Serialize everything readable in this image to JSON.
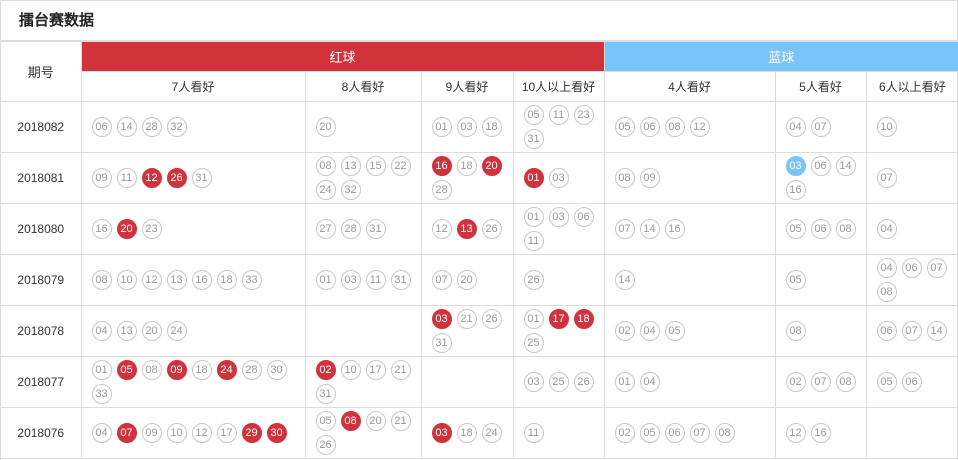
{
  "title": "擂台赛数据",
  "header": {
    "period_label": "期号",
    "red_label": "红球",
    "blue_label": "蓝球",
    "red_columns": [
      "7人看好",
      "8人看好",
      "9人看好",
      "10人以上看好"
    ],
    "blue_columns": [
      "4人看好",
      "5人看好",
      "6人以上看好"
    ]
  },
  "colors": {
    "red": "#d0333b",
    "blue": "#79c5fb",
    "border": "#dddddd"
  },
  "rows": [
    {
      "period": "2018082",
      "red": [
        [
          {
            "n": "06"
          },
          {
            "n": "14"
          },
          {
            "n": "28"
          },
          {
            "n": "32"
          }
        ],
        [
          {
            "n": "20"
          }
        ],
        [
          {
            "n": "01"
          },
          {
            "n": "03"
          },
          {
            "n": "18"
          }
        ],
        [
          {
            "n": "05"
          },
          {
            "n": "11"
          },
          {
            "n": "23"
          },
          {
            "n": "31"
          }
        ]
      ],
      "blue": [
        [
          {
            "n": "05"
          },
          {
            "n": "06"
          },
          {
            "n": "08"
          },
          {
            "n": "12"
          }
        ],
        [
          {
            "n": "04"
          },
          {
            "n": "07"
          }
        ],
        [
          {
            "n": "10"
          }
        ]
      ]
    },
    {
      "period": "2018081",
      "red": [
        [
          {
            "n": "09"
          },
          {
            "n": "11"
          },
          {
            "n": "12",
            "hit": true
          },
          {
            "n": "26",
            "hit": true
          },
          {
            "n": "31"
          }
        ],
        [
          {
            "n": "08"
          },
          {
            "n": "13"
          },
          {
            "n": "15"
          },
          {
            "n": "22"
          },
          {
            "n": "24"
          },
          {
            "n": "32"
          }
        ],
        [
          {
            "n": "16",
            "hit": true
          },
          {
            "n": "18"
          },
          {
            "n": "20",
            "hit": true
          },
          {
            "n": "28"
          }
        ],
        [
          {
            "n": "01",
            "hit": true
          },
          {
            "n": "03"
          }
        ]
      ],
      "blue": [
        [
          {
            "n": "08"
          },
          {
            "n": "09"
          }
        ],
        [
          {
            "n": "03",
            "hit": true
          },
          {
            "n": "06"
          },
          {
            "n": "14"
          },
          {
            "n": "16"
          }
        ],
        [
          {
            "n": "07"
          }
        ]
      ]
    },
    {
      "period": "2018080",
      "red": [
        [
          {
            "n": "16"
          },
          {
            "n": "20",
            "hit": true
          },
          {
            "n": "23"
          }
        ],
        [
          {
            "n": "27"
          },
          {
            "n": "28"
          },
          {
            "n": "31"
          }
        ],
        [
          {
            "n": "12"
          },
          {
            "n": "13",
            "hit": true
          },
          {
            "n": "26"
          }
        ],
        [
          {
            "n": "01"
          },
          {
            "n": "03"
          },
          {
            "n": "06"
          },
          {
            "n": "11"
          }
        ]
      ],
      "blue": [
        [
          {
            "n": "07"
          },
          {
            "n": "14"
          },
          {
            "n": "16"
          }
        ],
        [
          {
            "n": "05"
          },
          {
            "n": "06"
          },
          {
            "n": "08"
          }
        ],
        [
          {
            "n": "04"
          }
        ]
      ]
    },
    {
      "period": "2018079",
      "red": [
        [
          {
            "n": "08"
          },
          {
            "n": "10"
          },
          {
            "n": "12"
          },
          {
            "n": "13"
          },
          {
            "n": "16"
          },
          {
            "n": "18"
          },
          {
            "n": "33"
          }
        ],
        [
          {
            "n": "01"
          },
          {
            "n": "03"
          },
          {
            "n": "11"
          },
          {
            "n": "31"
          }
        ],
        [
          {
            "n": "07"
          },
          {
            "n": "20"
          }
        ],
        [
          {
            "n": "26"
          }
        ]
      ],
      "blue": [
        [
          {
            "n": "14"
          }
        ],
        [
          {
            "n": "05"
          }
        ],
        [
          {
            "n": "04"
          },
          {
            "n": "06"
          },
          {
            "n": "07"
          },
          {
            "n": "08"
          }
        ]
      ]
    },
    {
      "period": "2018078",
      "red": [
        [
          {
            "n": "04"
          },
          {
            "n": "13"
          },
          {
            "n": "20"
          },
          {
            "n": "24"
          }
        ],
        [],
        [
          {
            "n": "03",
            "hit": true
          },
          {
            "n": "21"
          },
          {
            "n": "26"
          },
          {
            "n": "31"
          }
        ],
        [
          {
            "n": "01"
          },
          {
            "n": "17",
            "hit": true
          },
          {
            "n": "18",
            "hit": true
          },
          {
            "n": "25"
          }
        ]
      ],
      "blue": [
        [
          {
            "n": "02"
          },
          {
            "n": "04"
          },
          {
            "n": "05"
          }
        ],
        [
          {
            "n": "08"
          }
        ],
        [
          {
            "n": "06"
          },
          {
            "n": "07"
          },
          {
            "n": "14"
          }
        ]
      ]
    },
    {
      "period": "2018077",
      "red": [
        [
          {
            "n": "01"
          },
          {
            "n": "05",
            "hit": true
          },
          {
            "n": "08"
          },
          {
            "n": "09",
            "hit": true
          },
          {
            "n": "18"
          },
          {
            "n": "24",
            "hit": true
          },
          {
            "n": "28"
          },
          {
            "n": "30"
          },
          {
            "n": "33"
          }
        ],
        [
          {
            "n": "02",
            "hit": true
          },
          {
            "n": "10"
          },
          {
            "n": "17"
          },
          {
            "n": "21"
          },
          {
            "n": "31"
          }
        ],
        [],
        [
          {
            "n": "03"
          },
          {
            "n": "25"
          },
          {
            "n": "26"
          }
        ]
      ],
      "blue": [
        [
          {
            "n": "01"
          },
          {
            "n": "04"
          }
        ],
        [
          {
            "n": "02"
          },
          {
            "n": "07"
          },
          {
            "n": "08"
          }
        ],
        [
          {
            "n": "05"
          },
          {
            "n": "06"
          }
        ]
      ]
    },
    {
      "period": "2018076",
      "red": [
        [
          {
            "n": "04"
          },
          {
            "n": "07",
            "hit": true
          },
          {
            "n": "09"
          },
          {
            "n": "10"
          },
          {
            "n": "12"
          },
          {
            "n": "17"
          },
          {
            "n": "29",
            "hit": true
          },
          {
            "n": "30",
            "hit": true
          }
        ],
        [
          {
            "n": "05"
          },
          {
            "n": "08",
            "hit": true
          },
          {
            "n": "20"
          },
          {
            "n": "21"
          },
          {
            "n": "26"
          }
        ],
        [
          {
            "n": "03",
            "hit": true
          },
          {
            "n": "18"
          },
          {
            "n": "24"
          }
        ],
        [
          {
            "n": "11"
          }
        ]
      ],
      "blue": [
        [
          {
            "n": "02"
          },
          {
            "n": "05"
          },
          {
            "n": "06"
          },
          {
            "n": "07"
          },
          {
            "n": "08"
          }
        ],
        [
          {
            "n": "12"
          },
          {
            "n": "16"
          }
        ],
        []
      ]
    }
  ]
}
